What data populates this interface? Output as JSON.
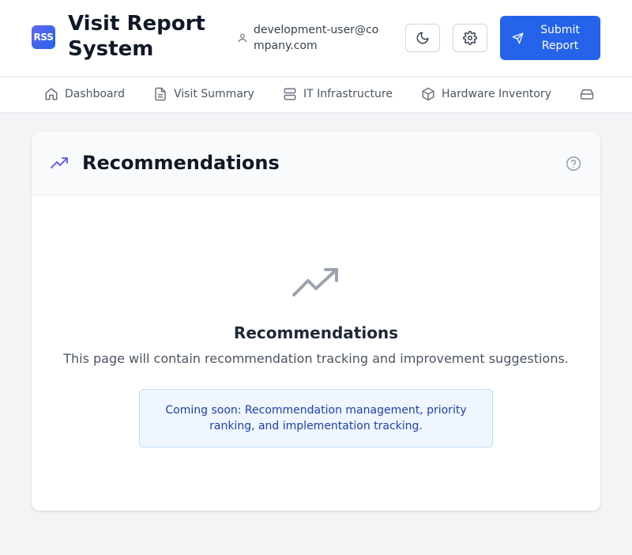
{
  "header": {
    "logo_text": "RSS",
    "app_title": "Visit Report System",
    "user_email": "development-user@company.com",
    "submit_label": "Submit Report"
  },
  "nav": {
    "items": [
      {
        "label": "Dashboard",
        "icon": "home-icon"
      },
      {
        "label": "Visit Summary",
        "icon": "document-icon"
      },
      {
        "label": "IT Infrastructure",
        "icon": "server-icon"
      },
      {
        "label": "Hardware Inventory",
        "icon": "box-icon"
      },
      {
        "label": "",
        "icon": "hard-drive-icon"
      }
    ]
  },
  "page": {
    "title": "Recommendations",
    "empty_title": "Recommendations",
    "empty_description": "This page will contain recommendation tracking and improvement suggestions.",
    "notice": "Coming soon: Recommendation management, priority ranking, and implementation tracking."
  },
  "colors": {
    "primary": "#2563eb",
    "accent": "#6366f1",
    "page_bg": "#f3f4f6",
    "notice_bg": "#eff6ff",
    "notice_text": "#1e40af"
  }
}
